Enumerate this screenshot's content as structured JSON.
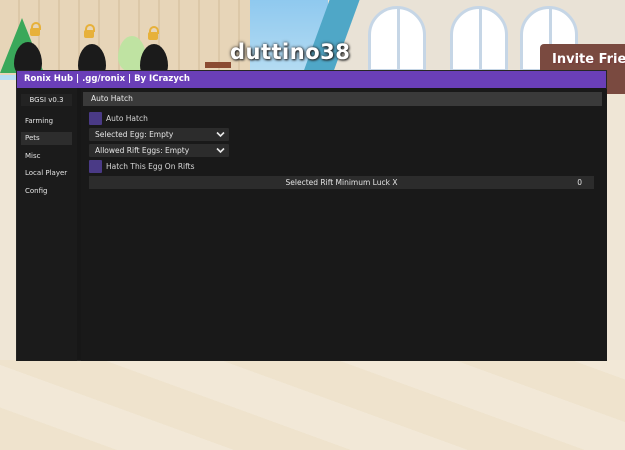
{
  "background": {
    "player_name": "duttino38",
    "invite_text": "Invite Friend"
  },
  "window": {
    "title": "Ronix Hub | .gg/ronix | By ICrazych",
    "accent_color": "#6a3fb8",
    "version": "BGSI v0.3"
  },
  "sidebar": {
    "items": [
      {
        "label": "Farming",
        "active": false
      },
      {
        "label": "Pets",
        "active": true
      },
      {
        "label": "Misc",
        "active": false
      },
      {
        "label": "Local Player",
        "active": false
      },
      {
        "label": "Config",
        "active": false
      }
    ]
  },
  "main": {
    "section_title": "Auto Hatch",
    "auto_hatch_toggle": {
      "label": "Auto Hatch"
    },
    "selected_egg_dropdown": {
      "label": "Selected Egg: Empty"
    },
    "allowed_rift_dropdown": {
      "label": "Allowed Rift Eggs: Empty"
    },
    "hatch_rifts_toggle": {
      "label": "Hatch This Egg On Rifts"
    },
    "luck_slider": {
      "label": "Selected Rift Minimum Luck X",
      "value": "0"
    }
  }
}
